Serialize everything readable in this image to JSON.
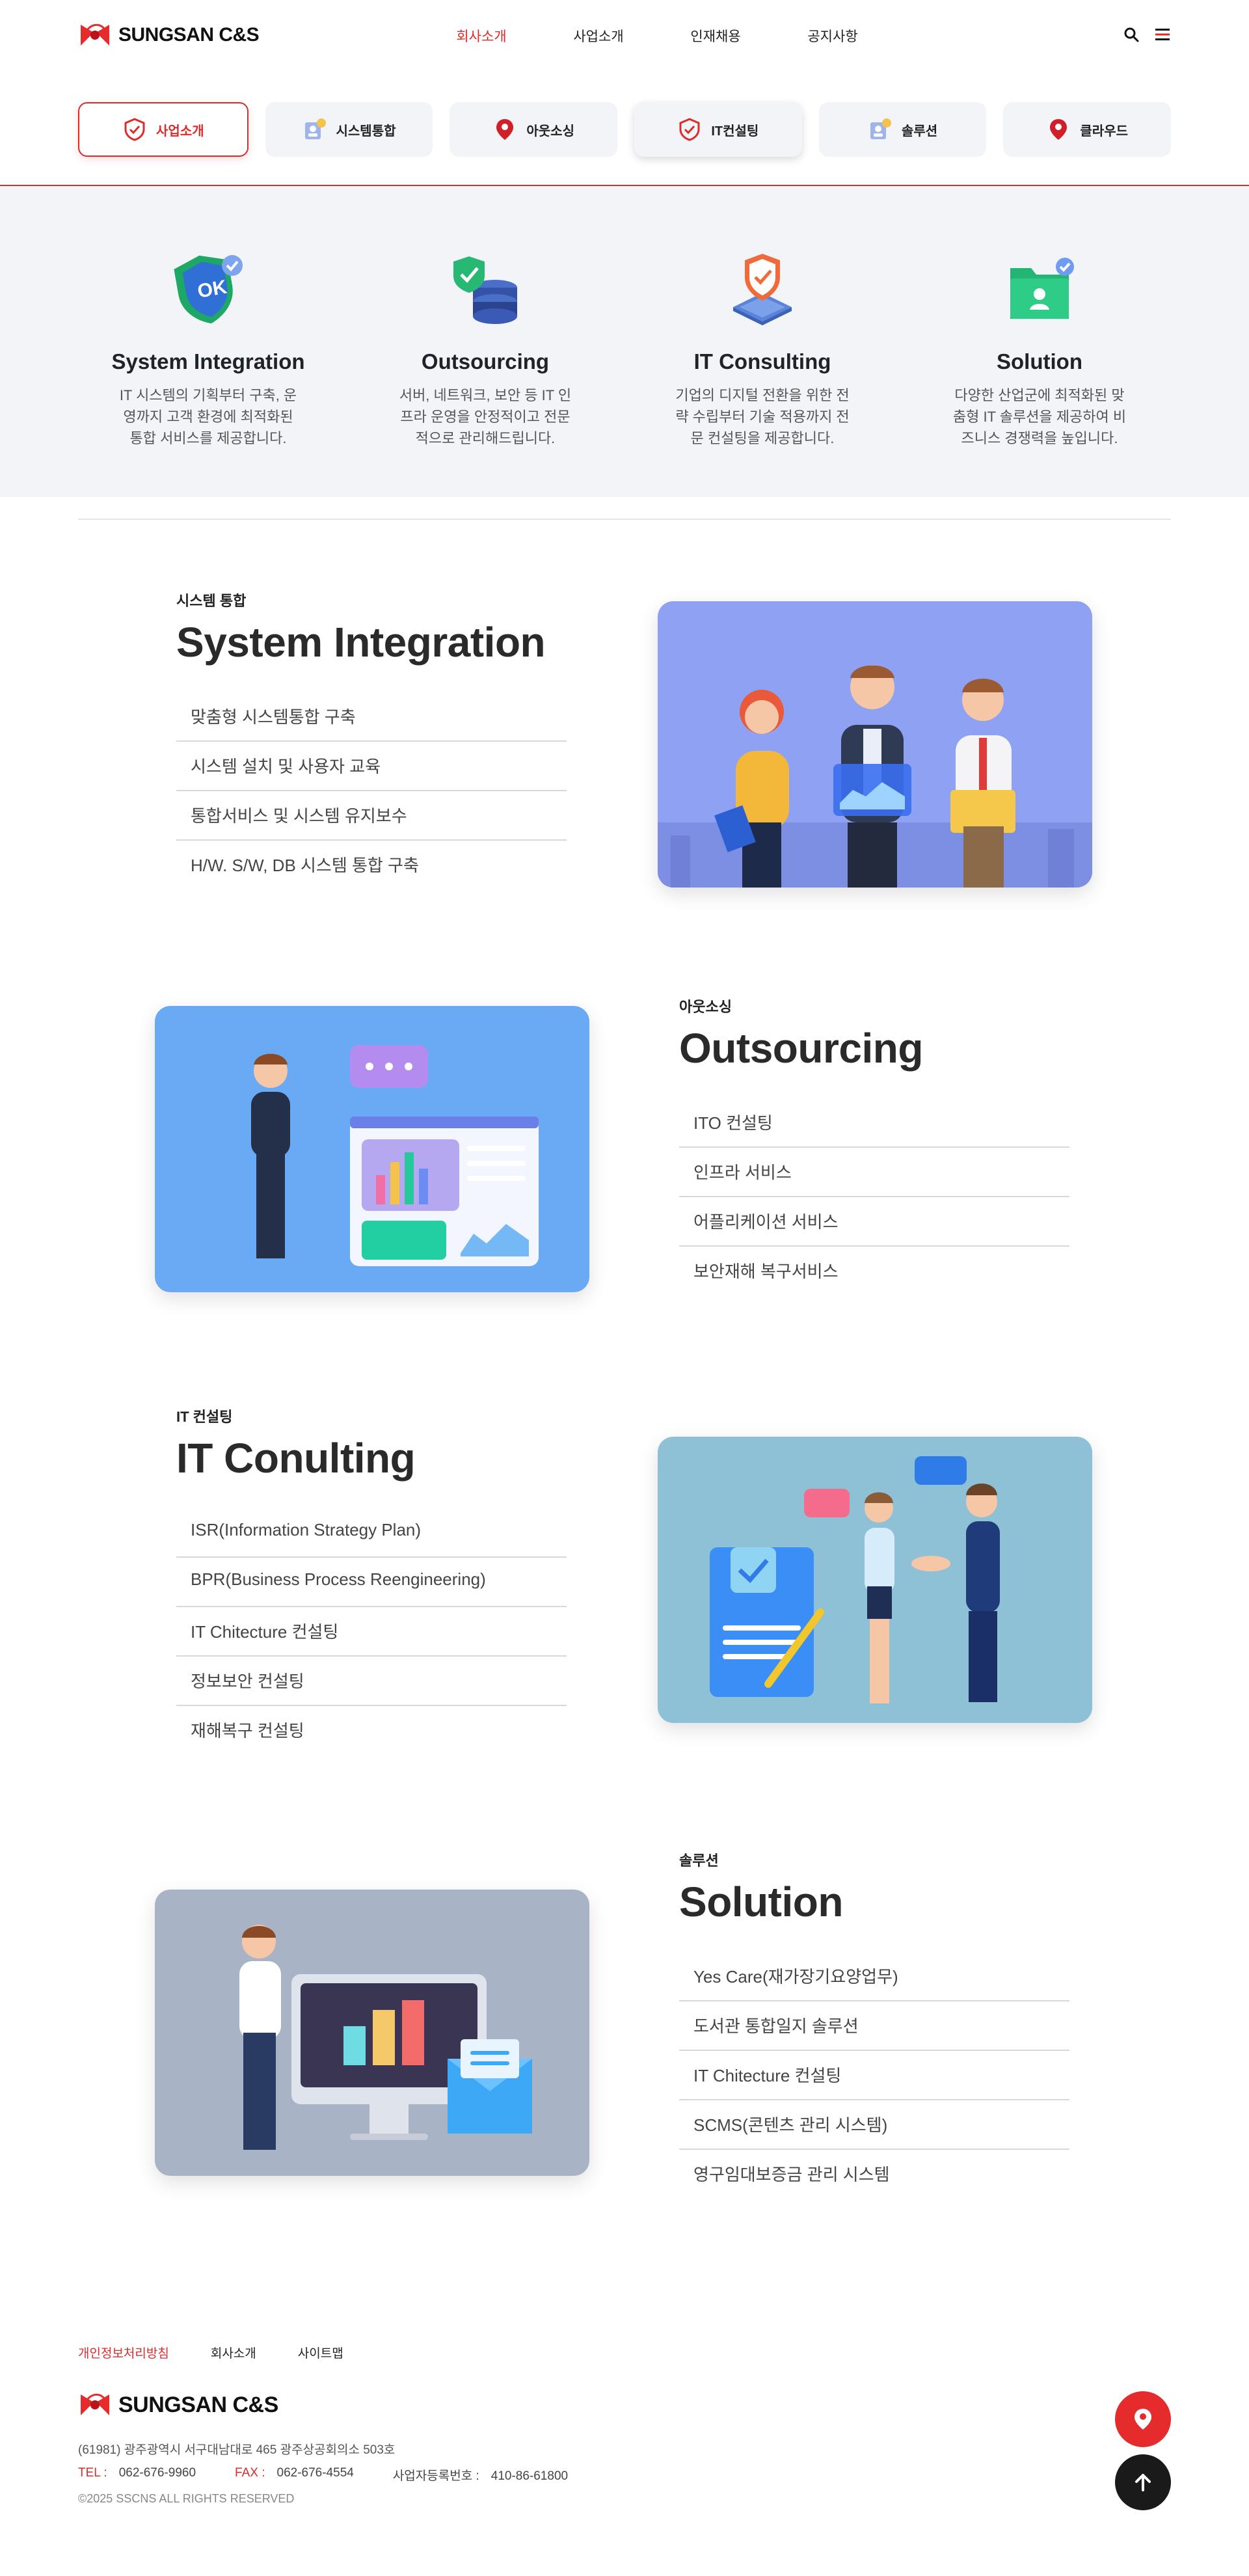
{
  "brand": {
    "name": "SUNGSAN C&S"
  },
  "nav": {
    "items": [
      "회사소개",
      "사업소개",
      "인재채용",
      "공지사항"
    ],
    "active_index": 0,
    "search_icon": "search-icon",
    "menu_icon": "hamburger-menu-icon"
  },
  "tabs": [
    {
      "label": "사업소개",
      "icon": "shield-check-icon",
      "state": "active"
    },
    {
      "label": "시스템통합",
      "icon": "badge-person-icon",
      "state": "default"
    },
    {
      "label": "아웃소싱",
      "icon": "location-pin-icon",
      "state": "default"
    },
    {
      "label": "IT컨설팅",
      "icon": "shield-check-icon",
      "state": "hover"
    },
    {
      "label": "솔루션",
      "icon": "badge-person-icon",
      "state": "default"
    },
    {
      "label": "클라우드",
      "icon": "location-pin-icon",
      "state": "default"
    }
  ],
  "overview": [
    {
      "title": "System Integration",
      "desc": "IT 시스템의 기획부터 구축, 운영까지 고객 환경에 최적화된 통합 서비스를 제공합니다.",
      "icon": "ok-shield-icon"
    },
    {
      "title": "Outsourcing",
      "desc": "서버, 네트워크, 보안 등 IT 인프라 운영을 안정적이고 전문적으로 관리해드립니다.",
      "icon": "database-shield-icon"
    },
    {
      "title": "IT Consulting",
      "desc": "기업의 디지털 전환을 위한 전략 수립부터 기술 적용까지 전문 컨설팅을 제공합니다.",
      "icon": "chip-shield-icon"
    },
    {
      "title": "Solution",
      "desc": "다양한 산업군에 최적화된 맞춤형 IT 솔루션을 제공하여 비즈니스 경쟁력을 높입니다.",
      "icon": "folder-user-icon"
    }
  ],
  "sections": [
    {
      "kicker": "시스템 통합",
      "title": "System Integration",
      "items": [
        "맞춤형 시스템통합 구축",
        "시스템 설치 및 사용자 교육",
        "통합서비스 및 시스템 유지보수",
        "H/W. S/W, DB 시스템 통합 구축"
      ],
      "image": "team-of-three-illustration",
      "bg": "#8fa1f2"
    },
    {
      "kicker": "아웃소싱",
      "title": "Outsourcing",
      "items": [
        "ITO 컨설팅",
        "인프라 서비스",
        "어플리케이션 서비스",
        "보안재해 복구서비스"
      ],
      "image": "presenter-dashboard-illustration",
      "bg": "#6aaaf5"
    },
    {
      "kicker": "IT 컨설팅",
      "title": "IT Conulting",
      "items": [
        "ISR(Information Strategy Plan)",
        "BPR(Business Process Reengineering)",
        "IT Chitecture 컨설팅",
        "정보보안 컨설팅",
        "재해복구 컨설팅"
      ],
      "image": "handshake-contract-illustration",
      "bg": "#8ec0d6"
    },
    {
      "kicker": "솔루션",
      "title": "Solution",
      "items": [
        "Yes Care(재가장기요양업무)",
        "도서관 통합일지 솔루션",
        "IT Chitecture 컨설팅",
        "SCMS(콘텐츠 관리 시스템)",
        "영구임대보증금 관리 시스템"
      ],
      "image": "monitor-chart-mail-illustration",
      "bg": "#a9b3c6"
    }
  ],
  "footer": {
    "links": [
      "개인정보처리방침",
      "회사소개",
      "사이트맵"
    ],
    "address": "(61981) 광주광역시 서구대남대로 465 광주상공회의소 503호",
    "tel_label": "TEL :",
    "tel": "062-676-9960",
    "fax_label": "FAX :",
    "fax": "062-676-4554",
    "biz_label": "사업자등록번호 :",
    "biz": "410-86-61800",
    "copyright": "©2025 SSCNS ALL RIGHTS RESERVED"
  },
  "colors": {
    "accent": "#e02a2a",
    "band": "#f3f4f7",
    "dark": "#1a1a1a"
  }
}
